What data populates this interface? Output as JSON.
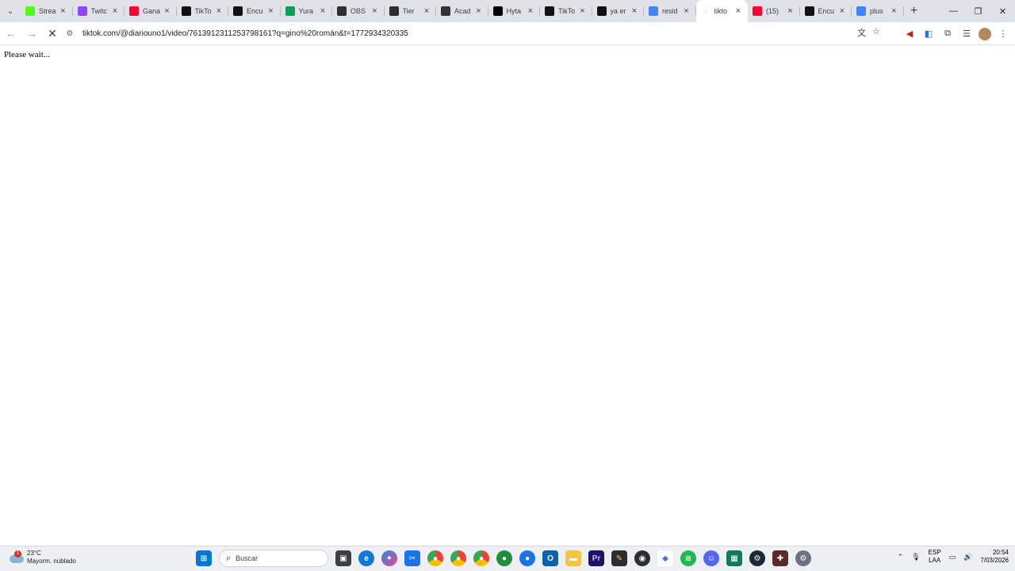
{
  "tabs": [
    {
      "title": "Strea",
      "icon": "kick-icon",
      "color": "#53fc18"
    },
    {
      "title": "Twitc",
      "icon": "twitch-icon",
      "color": "#9146ff"
    },
    {
      "title": "Gana",
      "icon": "youtube-icon",
      "color": "#ff0033"
    },
    {
      "title": "TikTo",
      "icon": "tiktok-icon",
      "color": "#111111"
    },
    {
      "title": "Encu",
      "icon": "tiktok-icon",
      "color": "#111111"
    },
    {
      "title": "Yura",
      "icon": "sheets-icon",
      "color": "#0f9d58"
    },
    {
      "title": "OBS",
      "icon": "obs-icon",
      "color": "#302e31"
    },
    {
      "title": "Tier",
      "icon": "tier-icon",
      "color": "#2d2d2d"
    },
    {
      "title": "Acad",
      "icon": "academy-icon",
      "color": "#333333"
    },
    {
      "title": "Hyta",
      "icon": "x-icon",
      "color": "#000000"
    },
    {
      "title": "TikTo",
      "icon": "tiktok-icon",
      "color": "#111111"
    },
    {
      "title": "ya er",
      "icon": "tiktok-icon",
      "color": "#111111"
    },
    {
      "title": "resid",
      "icon": "google-icon",
      "color": "#4285f4"
    },
    {
      "title": "tikto",
      "icon": "loading-icon",
      "color": "#5f6368",
      "active": true
    },
    {
      "title": "(15)",
      "icon": "youtube-icon",
      "color": "#ff0033"
    },
    {
      "title": "Encu",
      "icon": "tiktok-icon",
      "color": "#111111"
    },
    {
      "title": "plus",
      "icon": "google-icon",
      "color": "#4285f4"
    }
  ],
  "address": {
    "url": "tiktok.com/@diariouno1/video/7613912311253798161?q=gino%20román&t=1772934320335"
  },
  "page": {
    "message": "Please wait..."
  },
  "taskbar": {
    "weather_temp": "23°C",
    "weather_desc": "Mayorm. nublado",
    "weather_badge": "1",
    "search_placeholder": "Buscar",
    "lang_top": "ESP",
    "lang_bottom": "LAA",
    "time": "20:54",
    "date": "7/03/2026"
  }
}
